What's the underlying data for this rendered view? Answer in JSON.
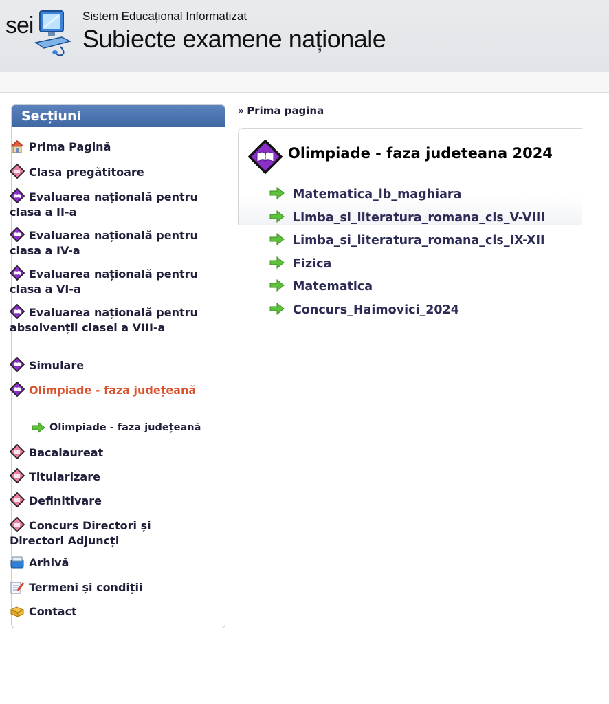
{
  "header": {
    "logo_text": "sei",
    "subtitle": "Sistem Educațional Informatizat",
    "title": "Subiecte examene naționale"
  },
  "sidebar": {
    "heading": "Secțiuni",
    "items": [
      {
        "label": "Prima Pagină",
        "icon": "home-icon"
      },
      {
        "label": "Clasa pregătitoare",
        "icon": "diamond-icon"
      },
      {
        "label": "Evaluarea națională pentru clasa a II-a",
        "icon": "diamond-book-icon"
      },
      {
        "label": "Evaluarea națională pentru clasa a IV-a",
        "icon": "diamond-book-icon"
      },
      {
        "label": "Evaluarea națională pentru clasa a VI-a",
        "icon": "diamond-book-icon"
      },
      {
        "label": "Evaluarea națională pentru absolvenții clasei a VIII-a",
        "icon": "diamond-book-icon"
      },
      {
        "label": "Simulare",
        "icon": "diamond-book-icon"
      },
      {
        "label": "Olimpiade - faza județeană",
        "icon": "diamond-book-icon",
        "active": true
      },
      {
        "label": "Olimpiade - faza județeană",
        "icon": "green-arrow-icon",
        "sub": true
      },
      {
        "label": "Bacalaureat",
        "icon": "diamond-icon"
      },
      {
        "label": "Titularizare",
        "icon": "diamond-icon"
      },
      {
        "label": "Definitivare",
        "icon": "diamond-icon"
      },
      {
        "label": "Concurs Directori și Directori Adjuncți",
        "icon": "diamond-icon"
      },
      {
        "label": "Arhivă",
        "icon": "archive-icon"
      },
      {
        "label": "Termeni și condiții",
        "icon": "notepad-icon"
      },
      {
        "label": "Contact",
        "icon": "contact-icon"
      }
    ]
  },
  "breadcrumb": {
    "separator": "»",
    "label": "Prima pagina"
  },
  "panel": {
    "title": "Olimpiade - faza judeteana 2024"
  },
  "links": [
    "Matematica_lb_maghiara",
    "Limba_si_literatura_romana_cls_V-VIII",
    "Limba_si_literatura_romana_cls_IX-XII",
    "Fizica",
    "Matematica",
    "Concurs_Haimovici_2024"
  ],
  "colors": {
    "accent": "#4a72b0",
    "active": "#d9532e",
    "diamond": "#e77fa0",
    "diamond_book": "#8b2fc9",
    "arrow": "#5cc23a"
  }
}
